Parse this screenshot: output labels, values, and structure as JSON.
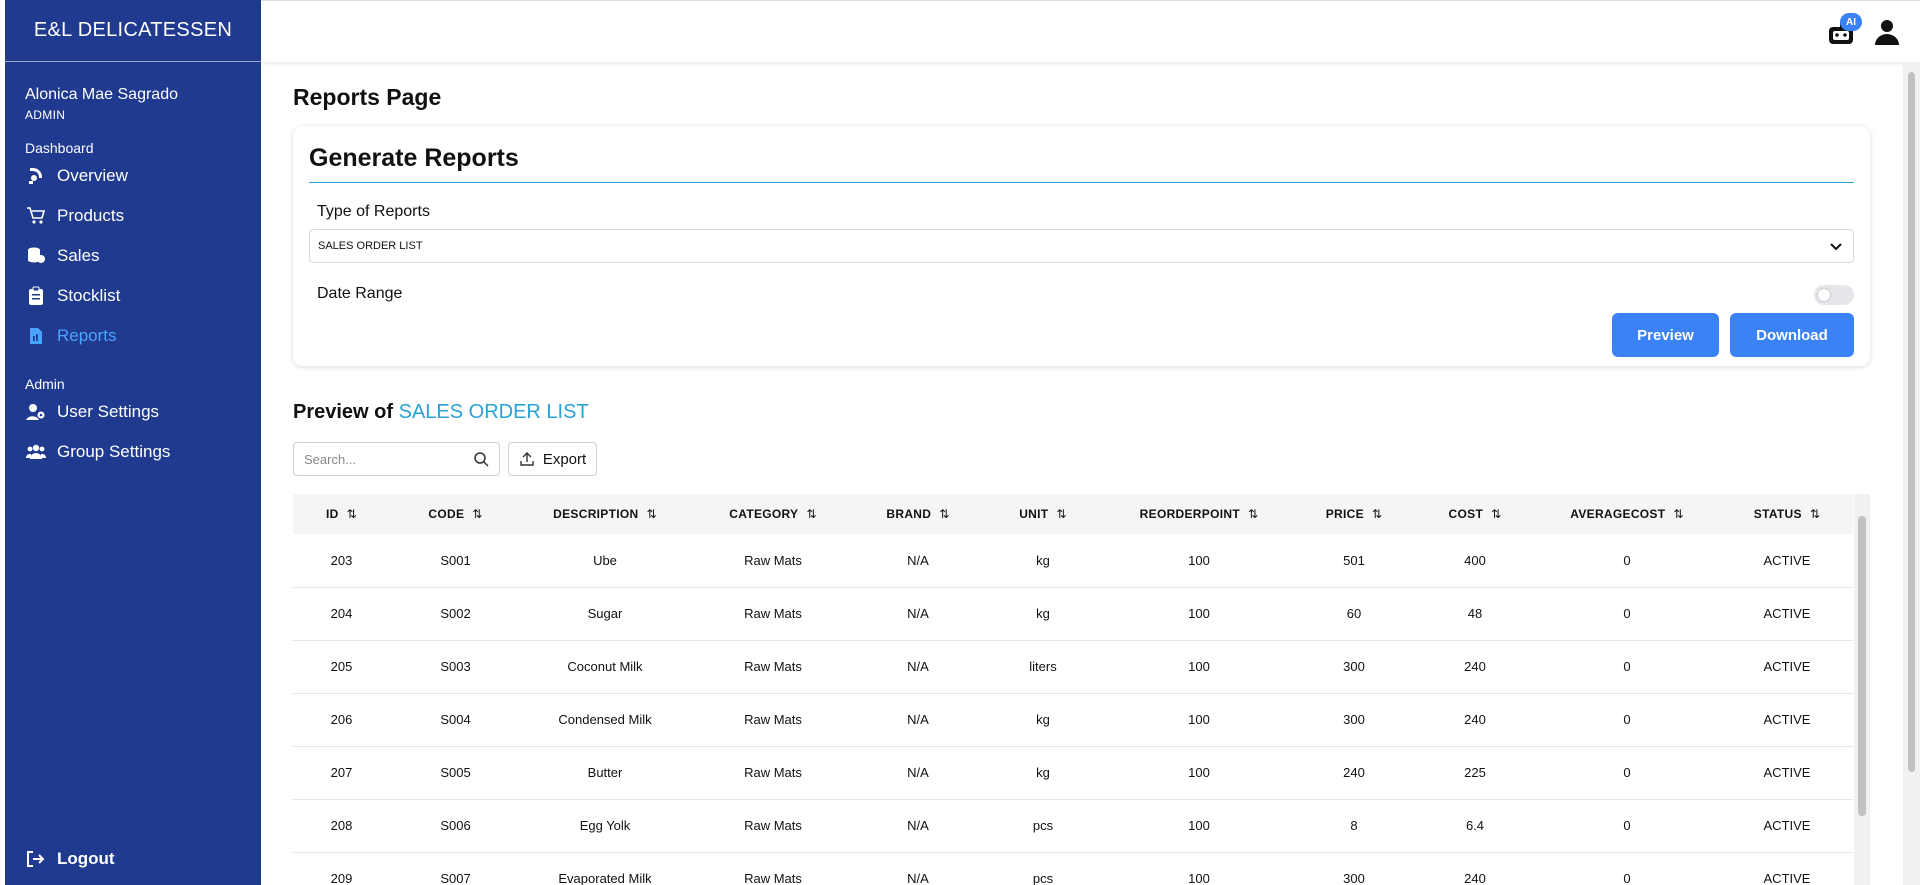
{
  "brand": "E&L DELICATESSEN",
  "user": {
    "name": "Alonica Mae Sagrado",
    "role": "ADMIN"
  },
  "sidebar": {
    "dashboard_label": "Dashboard",
    "admin_label": "Admin",
    "items": [
      {
        "label": "Overview",
        "icon": "overview-icon"
      },
      {
        "label": "Products",
        "icon": "cart-icon"
      },
      {
        "label": "Sales",
        "icon": "coins-icon"
      },
      {
        "label": "Stocklist",
        "icon": "clipboard-icon"
      },
      {
        "label": "Reports",
        "icon": "report-icon",
        "active": true
      }
    ],
    "admin_items": [
      {
        "label": "User Settings",
        "icon": "user-gear-icon"
      },
      {
        "label": "Group Settings",
        "icon": "users-icon"
      }
    ],
    "logout_label": "Logout"
  },
  "topbar": {
    "ai_badge": "AI"
  },
  "page": {
    "title": "Reports Page"
  },
  "generate": {
    "title": "Generate Reports",
    "type_label": "Type of Reports",
    "selected_type": "SALES ORDER LIST",
    "date_range_label": "Date Range",
    "date_range_enabled": false,
    "preview_label": "Preview",
    "download_label": "Download"
  },
  "preview": {
    "heading_prefix": "Preview of",
    "heading_highlight": "SALES ORDER LIST",
    "search_placeholder": "Search...",
    "export_label": "Export"
  },
  "colors": {
    "sidebar": "#1f3a8f",
    "accent": "#3b82f6",
    "highlight": "#29a3d6",
    "active_nav": "#4aa3ff"
  },
  "table": {
    "columns": [
      "ID",
      "CODE",
      "DESCRIPTION",
      "CATEGORY",
      "BRAND",
      "UNIT",
      "REORDERPOINT",
      "PRICE",
      "COST",
      "AVERAGECOST",
      "STATUS"
    ],
    "rows": [
      [
        "203",
        "S001",
        "Ube",
        "Raw Mats",
        "N/A",
        "kg",
        "100",
        "501",
        "400",
        "0",
        "ACTIVE"
      ],
      [
        "204",
        "S002",
        "Sugar",
        "Raw Mats",
        "N/A",
        "kg",
        "100",
        "60",
        "48",
        "0",
        "ACTIVE"
      ],
      [
        "205",
        "S003",
        "Coconut Milk",
        "Raw Mats",
        "N/A",
        "liters",
        "100",
        "300",
        "240",
        "0",
        "ACTIVE"
      ],
      [
        "206",
        "S004",
        "Condensed Milk",
        "Raw Mats",
        "N/A",
        "kg",
        "100",
        "300",
        "240",
        "0",
        "ACTIVE"
      ],
      [
        "207",
        "S005",
        "Butter",
        "Raw Mats",
        "N/A",
        "kg",
        "100",
        "240",
        "225",
        "0",
        "ACTIVE"
      ],
      [
        "208",
        "S006",
        "Egg Yolk",
        "Raw Mats",
        "N/A",
        "pcs",
        "100",
        "8",
        "6.4",
        "0",
        "ACTIVE"
      ],
      [
        "209",
        "S007",
        "Evaporated Milk",
        "Raw Mats",
        "N/A",
        "pcs",
        "100",
        "300",
        "240",
        "0",
        "ACTIVE"
      ]
    ]
  }
}
